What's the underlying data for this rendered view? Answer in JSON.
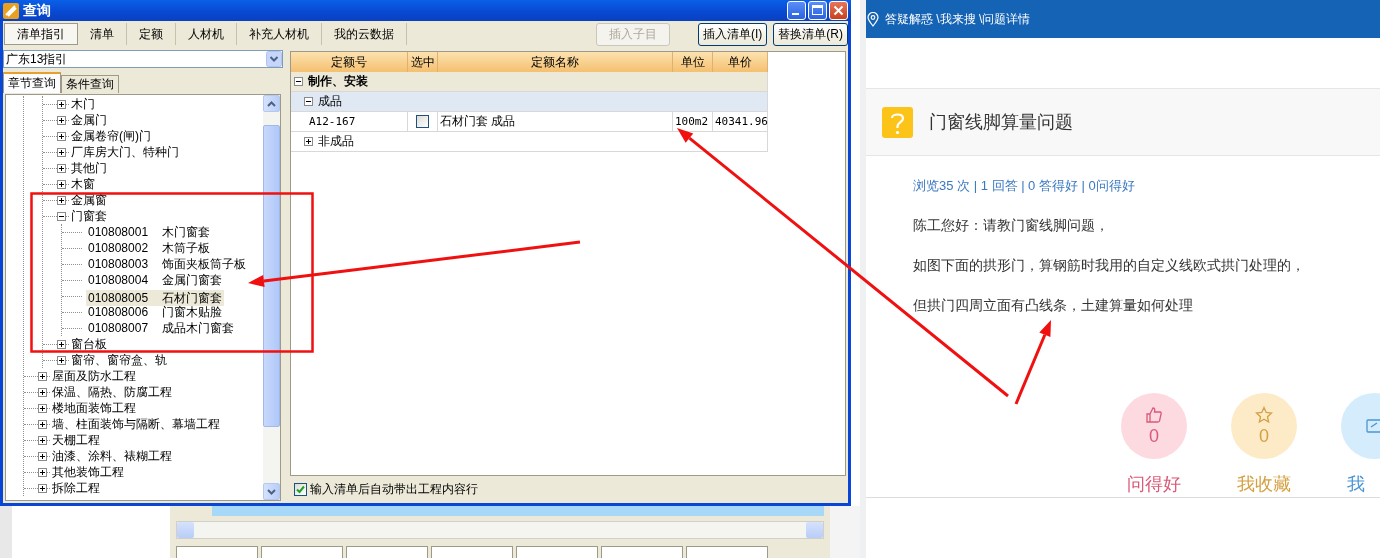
{
  "dialog": {
    "title": "查询",
    "tabs": [
      {
        "label": "清单指引",
        "selected": true
      },
      {
        "label": "清单",
        "selected": false
      },
      {
        "label": "定额",
        "selected": false
      },
      {
        "label": "人材机",
        "selected": false
      },
      {
        "label": "补充人材机",
        "selected": false
      },
      {
        "label": "我的云数据",
        "selected": false
      }
    ],
    "buttons": [
      {
        "label": "插入子目",
        "disabled": true
      },
      {
        "label": "插入清单(I)",
        "disabled": false
      },
      {
        "label": "替换清单(R)",
        "disabled": false
      }
    ],
    "guide_select": {
      "value": "广东13指引"
    },
    "subtabs": [
      {
        "label": "章节查询",
        "selected": true
      },
      {
        "label": "条件查询",
        "selected": false
      }
    ],
    "tree": [
      {
        "children": [
          {
            "children": [
              {
                "label": "木门",
                "expanded": false,
                "selected": false
              },
              {
                "label": "金属门",
                "expanded": false,
                "selected": false
              },
              {
                "label": "金属卷帘(闸)门",
                "expanded": false,
                "selected": false
              },
              {
                "label": "厂库房大门、特种门",
                "expanded": false,
                "selected": false
              },
              {
                "label": "其他门",
                "expanded": false,
                "selected": false
              },
              {
                "label": "木窗",
                "expanded": false,
                "selected": false
              },
              {
                "label": "金属窗",
                "expanded": false,
                "selected": false
              },
              {
                "label": "门窗套",
                "expanded": true,
                "selected": false,
                "children": [
                  {
                    "code": "010808001",
                    "label": "木门窗套",
                    "selected": false
                  },
                  {
                    "code": "010808002",
                    "label": "木筒子板",
                    "selected": false
                  },
                  {
                    "code": "010808003",
                    "label": "饰面夹板筒子板",
                    "selected": false
                  },
                  {
                    "code": "010808004",
                    "label": "金属门窗套",
                    "selected": false
                  },
                  {
                    "code": "010808005",
                    "label": "石材门窗套",
                    "selected": true
                  },
                  {
                    "code": "010808006",
                    "label": "门窗木贴脸",
                    "selected": false
                  },
                  {
                    "code": "010808007",
                    "label": "成品木门窗套",
                    "selected": false
                  }
                ]
              },
              {
                "label": "窗台板",
                "expanded": false,
                "selected": false
              },
              {
                "label": "窗帘、窗帘盒、轨",
                "expanded": false,
                "selected": false
              }
            ]
          },
          {
            "label": "屋面及防水工程",
            "expanded": false,
            "selected": false
          },
          {
            "label": "保温、隔热、防腐工程",
            "expanded": false,
            "selected": false
          },
          {
            "label": "楼地面装饰工程",
            "expanded": false,
            "selected": false
          },
          {
            "label": "墙、柱面装饰与隔断、幕墙工程",
            "expanded": false,
            "selected": false
          },
          {
            "label": "天棚工程",
            "expanded": false,
            "selected": false
          },
          {
            "label": "油漆、涂料、裱糊工程",
            "expanded": false,
            "selected": false
          },
          {
            "label": "其他装饰工程",
            "expanded": false,
            "selected": false
          },
          {
            "label": "拆除工程",
            "expanded": false,
            "selected": false
          }
        ]
      }
    ],
    "table": {
      "columns": [
        "定额号",
        "选中",
        "定额名称",
        "单位",
        "单价"
      ],
      "rows": [
        {
          "kind": "group",
          "label": "制作、安装",
          "expanded": true,
          "selected": false
        },
        {
          "kind": "subgroup",
          "label": "成品",
          "expanded": true,
          "selected": true
        },
        {
          "kind": "item",
          "code": "A12-167",
          "checked": false,
          "name": "石材门套 成品",
          "unit": "100m2",
          "price": "40341.96",
          "selected": false
        },
        {
          "kind": "subgroup",
          "label": "非成品",
          "expanded": false,
          "selected": false
        }
      ]
    },
    "auto_content": {
      "label": "输入清单后自动带出工程内容行",
      "checked": true
    }
  },
  "page": {
    "breadcrumb": "答疑解惑 \\我来搜 \\问题详情",
    "question": {
      "title": "门窗线脚算量问题",
      "stats": "浏览35 次 | 1 回答 | 0 答得好 | 0问得好",
      "paragraphs": [
        "陈工您好：请教门窗线脚问题，",
        "如图下面的拱形门，算钢筋时我用的自定义线欧式拱门处理的，",
        "但拱门四周立面有凸线条，土建算量如何处理"
      ]
    },
    "actions": [
      {
        "kind": "like",
        "count": "0",
        "label": "问得好"
      },
      {
        "kind": "favorite",
        "count": "0",
        "label": "我收藏"
      },
      {
        "kind": "share",
        "label": "我"
      }
    ]
  }
}
